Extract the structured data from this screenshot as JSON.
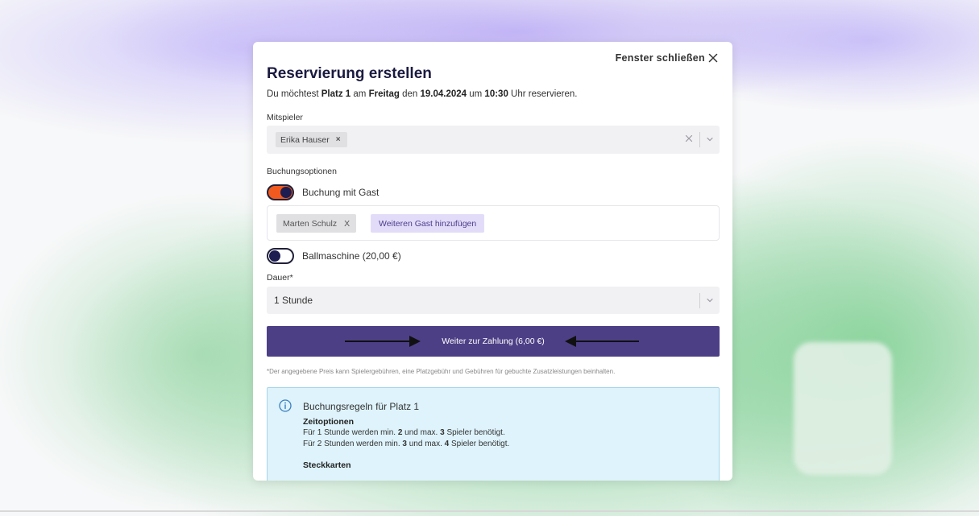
{
  "modal": {
    "close_label": "Fenster schließen",
    "title": "Reservierung erstellen",
    "subtitle": {
      "p1": "Du möchtest ",
      "court": "Platz 1",
      "p2": " am ",
      "day": "Freitag",
      "p3": " den ",
      "date": "19.04.2024",
      "p4": " um ",
      "time": "10:30",
      "p5": " Uhr reservieren."
    }
  },
  "players": {
    "label": "Mitspieler",
    "chips": [
      {
        "name": "Erika Hauser",
        "remove": "×"
      }
    ]
  },
  "options": {
    "label": "Buchungsoptionen",
    "guest_toggle": {
      "label": "Buchung mit Gast",
      "on": true
    },
    "guests": [
      {
        "name": "Marten Schulz",
        "remove": "X"
      }
    ],
    "add_guest_label": "Weiteren Gast hinzufügen",
    "ball_machine_toggle": {
      "label": "Ballmaschine (20,00 €)",
      "on": false
    }
  },
  "duration": {
    "label": "Dauer*",
    "value": "1 Stunde"
  },
  "payment": {
    "button_label": "Weiter zur Zahlung (6,00 €)"
  },
  "disclaimer": "*Der angegebene Preis kann Spielergebühren, eine Platzgebühr und Gebühren für gebuchte Zusatzleistungen beinhalten.",
  "rules": {
    "title": "Buchungsregeln für Platz 1",
    "time_options_heading": "Zeitoptionen",
    "line1": {
      "a": "Für 1 Stunde werden min. ",
      "min": "2",
      "b": " und max. ",
      "max": "3",
      "c": " Spieler benötigt."
    },
    "line2": {
      "a": "Für 2 Stunden werden min. ",
      "min": "3",
      "b": " und max. ",
      "max": "4",
      "c": " Spieler benötigt."
    },
    "punch_cards_heading": "Steckkarten"
  },
  "colors": {
    "accent_primary": "#4d3f86",
    "toggle_on": "#f05a1e",
    "info_bg": "#def3fb"
  }
}
